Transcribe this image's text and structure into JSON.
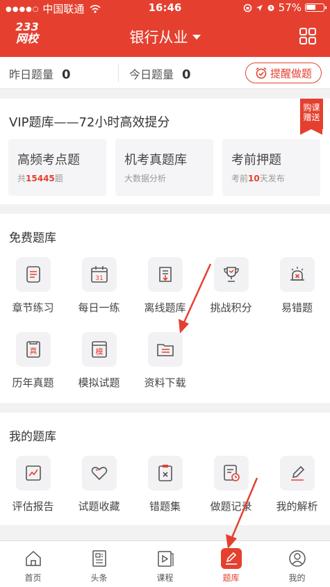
{
  "status_bar": {
    "carrier": "中国联通",
    "time": "16:46",
    "battery": "57%",
    "battery_level": 0.57
  },
  "header": {
    "logo_line1": "233",
    "logo_line2": "网校",
    "title": "银行从业"
  },
  "stats": {
    "yesterday_label": "昨日题量",
    "yesterday_value": "0",
    "today_label": "今日题量",
    "today_value": "0",
    "remind_label": "提醒做题"
  },
  "vip": {
    "title": "VIP题库——72小时高效提分",
    "ribbon_line1": "购课",
    "ribbon_line2": "赠送",
    "cards": [
      {
        "title": "高频考点题",
        "sub_pre": "共",
        "sub_num": "15445",
        "sub_post": "题"
      },
      {
        "title": "机考真题库",
        "sub_pre": "大数据分析",
        "sub_num": "",
        "sub_post": ""
      },
      {
        "title": "考前押题",
        "sub_pre": "考前",
        "sub_num": "10",
        "sub_post": "天发布"
      }
    ]
  },
  "free_bank": {
    "title": "免费题库",
    "items": [
      {
        "label": "章节练习",
        "icon": "list-doc-icon"
      },
      {
        "label": "每日一练",
        "icon": "calendar-icon",
        "icon_text": "31"
      },
      {
        "label": "离线题库",
        "icon": "offline-scroll-icon"
      },
      {
        "label": "挑战积分",
        "icon": "trophy-icon"
      },
      {
        "label": "易错题",
        "icon": "alarm-icon"
      },
      {
        "label": "历年真题",
        "icon": "past-exam-icon",
        "icon_text": "真"
      },
      {
        "label": "模拟试题",
        "icon": "mock-exam-icon",
        "icon_text": "模"
      },
      {
        "label": "资料下载",
        "icon": "folder-icon"
      }
    ]
  },
  "my_bank": {
    "title": "我的题库",
    "items": [
      {
        "label": "评估报告",
        "icon": "report-chart-icon"
      },
      {
        "label": "试题收藏",
        "icon": "heart-icon"
      },
      {
        "label": "错题集",
        "icon": "wrong-clipboard-icon"
      },
      {
        "label": "做题记录",
        "icon": "record-clock-icon"
      },
      {
        "label": "我的解析",
        "icon": "edit-pen-icon"
      }
    ]
  },
  "tabbar": {
    "items": [
      {
        "label": "首页",
        "icon": "home-icon"
      },
      {
        "label": "头条",
        "icon": "news-icon"
      },
      {
        "label": "课程",
        "icon": "play-course-icon"
      },
      {
        "label": "题库",
        "icon": "question-bank-icon",
        "active": true
      },
      {
        "label": "我的",
        "icon": "user-icon"
      }
    ]
  },
  "colors": {
    "brand": "#e5402f",
    "background": "#f2f2f2",
    "icon_gray": "#555555"
  }
}
